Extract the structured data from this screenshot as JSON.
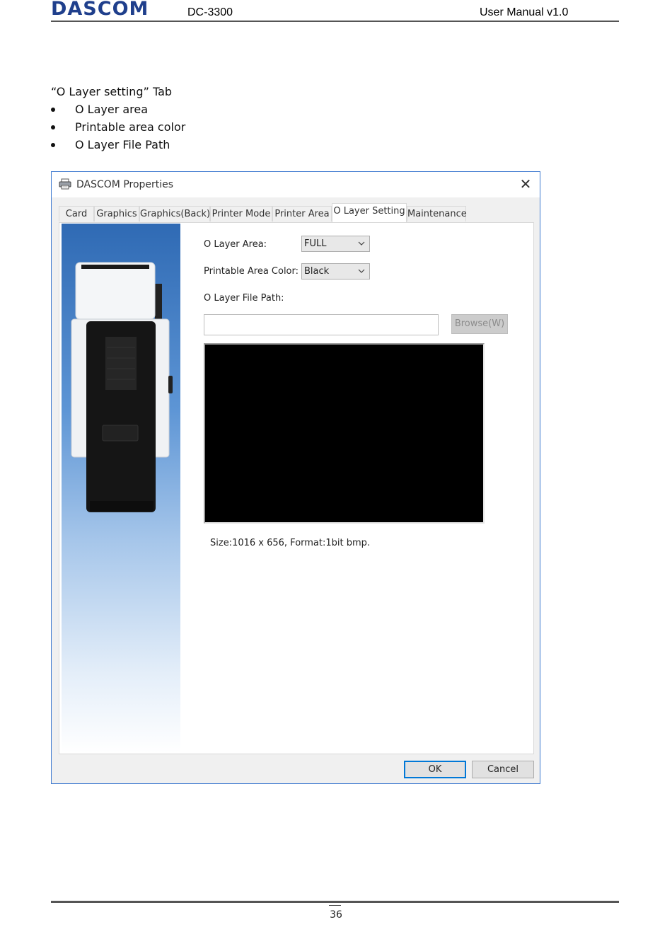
{
  "header": {
    "logo": "DASCOM",
    "model": "DC-3300",
    "manual": "User Manual v1.0"
  },
  "content": {
    "intro": "“O Layer setting” Tab",
    "bullets": [
      "O Layer area",
      "Printable area color",
      "O Layer File Path"
    ]
  },
  "dialog": {
    "title": "DASCOM Properties",
    "close_glyph": "✕",
    "tabs": [
      "Card",
      "Graphics",
      "Graphics(Back)",
      "Printer Mode",
      "Printer Area",
      "O Layer Setting",
      "Maintenance"
    ],
    "active_tab": "O Layer Setting",
    "o_layer_area_label": "O Layer Area:",
    "o_layer_area_value": "FULL",
    "printable_color_label": "Printable Area Color:",
    "printable_color_value": "Black",
    "file_path_label": "O Layer File Path:",
    "file_path_value": "",
    "browse_label": "Browse(W)",
    "size_text": "Size:1016 x 656, Format:1bit bmp.",
    "ok_label": "OK",
    "cancel_label": "Cancel",
    "preview_color": "#000000",
    "icons": [
      "printer-icon",
      "close-icon",
      "chevron-down-icon"
    ]
  },
  "footer": {
    "page_number": "36"
  }
}
